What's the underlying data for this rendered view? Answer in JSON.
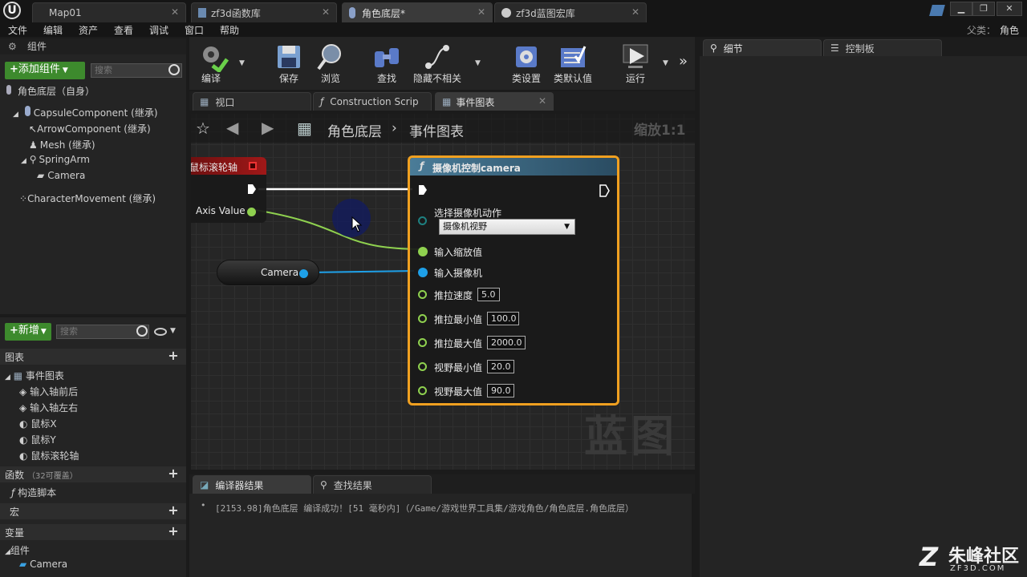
{
  "tabs": [
    {
      "label": "Map01"
    },
    {
      "label": "zf3d函数库"
    },
    {
      "label": "角色底层*"
    },
    {
      "label": "zf3d蓝图宏库"
    }
  ],
  "menu": [
    "文件",
    "编辑",
    "资产",
    "查看",
    "调试",
    "窗口",
    "帮助"
  ],
  "parent_class": {
    "label": "父类：",
    "value": "角色"
  },
  "components_panel": {
    "title": "组件",
    "add_button": "添加组件",
    "search_placeholder": "搜索",
    "self_item": "角色底层（自身）",
    "items": [
      "CapsuleComponent (继承)",
      "ArrowComponent (继承)",
      "Mesh (继承)",
      "SpringArm",
      "Camera",
      "CharacterMovement (继承)"
    ]
  },
  "toolbar": {
    "compile": "编译",
    "save": "保存",
    "browse": "浏览",
    "find": "查找",
    "hide_unrelated": "隐藏不相关",
    "class_settings": "类设置",
    "class_defaults": "类默认值",
    "run": "运行"
  },
  "editor_tabs": [
    {
      "label": "视口"
    },
    {
      "label": "Construction Scrip"
    },
    {
      "label": "事件图表"
    }
  ],
  "graph": {
    "breadcrumb_root": "角色底层",
    "breadcrumb_leaf": "事件图表",
    "zoom": "缩放1:1",
    "watermark": "蓝图"
  },
  "event_node": {
    "title": "鼠标滚轮轴",
    "output": "Axis Value"
  },
  "camera_node": {
    "label": "Camera"
  },
  "function_node": {
    "title": "摄像机控制camera",
    "select_label": "选择摄像机动作",
    "select_value": "摄像机视野",
    "zoom_input": "输入缩放值",
    "camera_input": "输入摄像机",
    "params": [
      {
        "label": "推拉速度",
        "value": "5.0"
      },
      {
        "label": "推拉最小值",
        "value": "100.0"
      },
      {
        "label": "推拉最大值",
        "value": "2000.0"
      },
      {
        "label": "视野最小值",
        "value": "20.0"
      },
      {
        "label": "视野最大值",
        "value": "90.0"
      }
    ]
  },
  "my_blueprint": {
    "new_button": "新增",
    "search_placeholder": "搜索",
    "graphs_header": "图表",
    "event_graph": "事件图表",
    "events": [
      "输入轴前后",
      "输入轴左右",
      "鼠标X",
      "鼠标Y",
      "鼠标滚轮轴"
    ],
    "functions_header": "函数",
    "functions_override": "（32可覆盖）",
    "construct_script": "构造脚本",
    "macros_header": "宏",
    "variables_header": "变量",
    "components_header": "组件",
    "component_camera": "Camera"
  },
  "bottom": {
    "compiler_tab": "编译器结果",
    "find_tab": "查找结果",
    "log": "[2153.98]角色底层 编译成功！[51 毫秒内]（/Game/游戏世界工具集/游戏角色/角色底层.角色底层）"
  },
  "right_panel": {
    "details_tab": "细节",
    "palette_tab": "控制板"
  },
  "logo": {
    "name": "朱峰社区",
    "url_text": "ZF3D.COM"
  },
  "colors": {
    "exec_white": "#ffffff",
    "float_green": "#8fd14f",
    "object_blue": "#1ea0e8",
    "event_red": "#a01818",
    "function_blue": "#3a6e8a",
    "selection_orange": "#f0a020"
  }
}
